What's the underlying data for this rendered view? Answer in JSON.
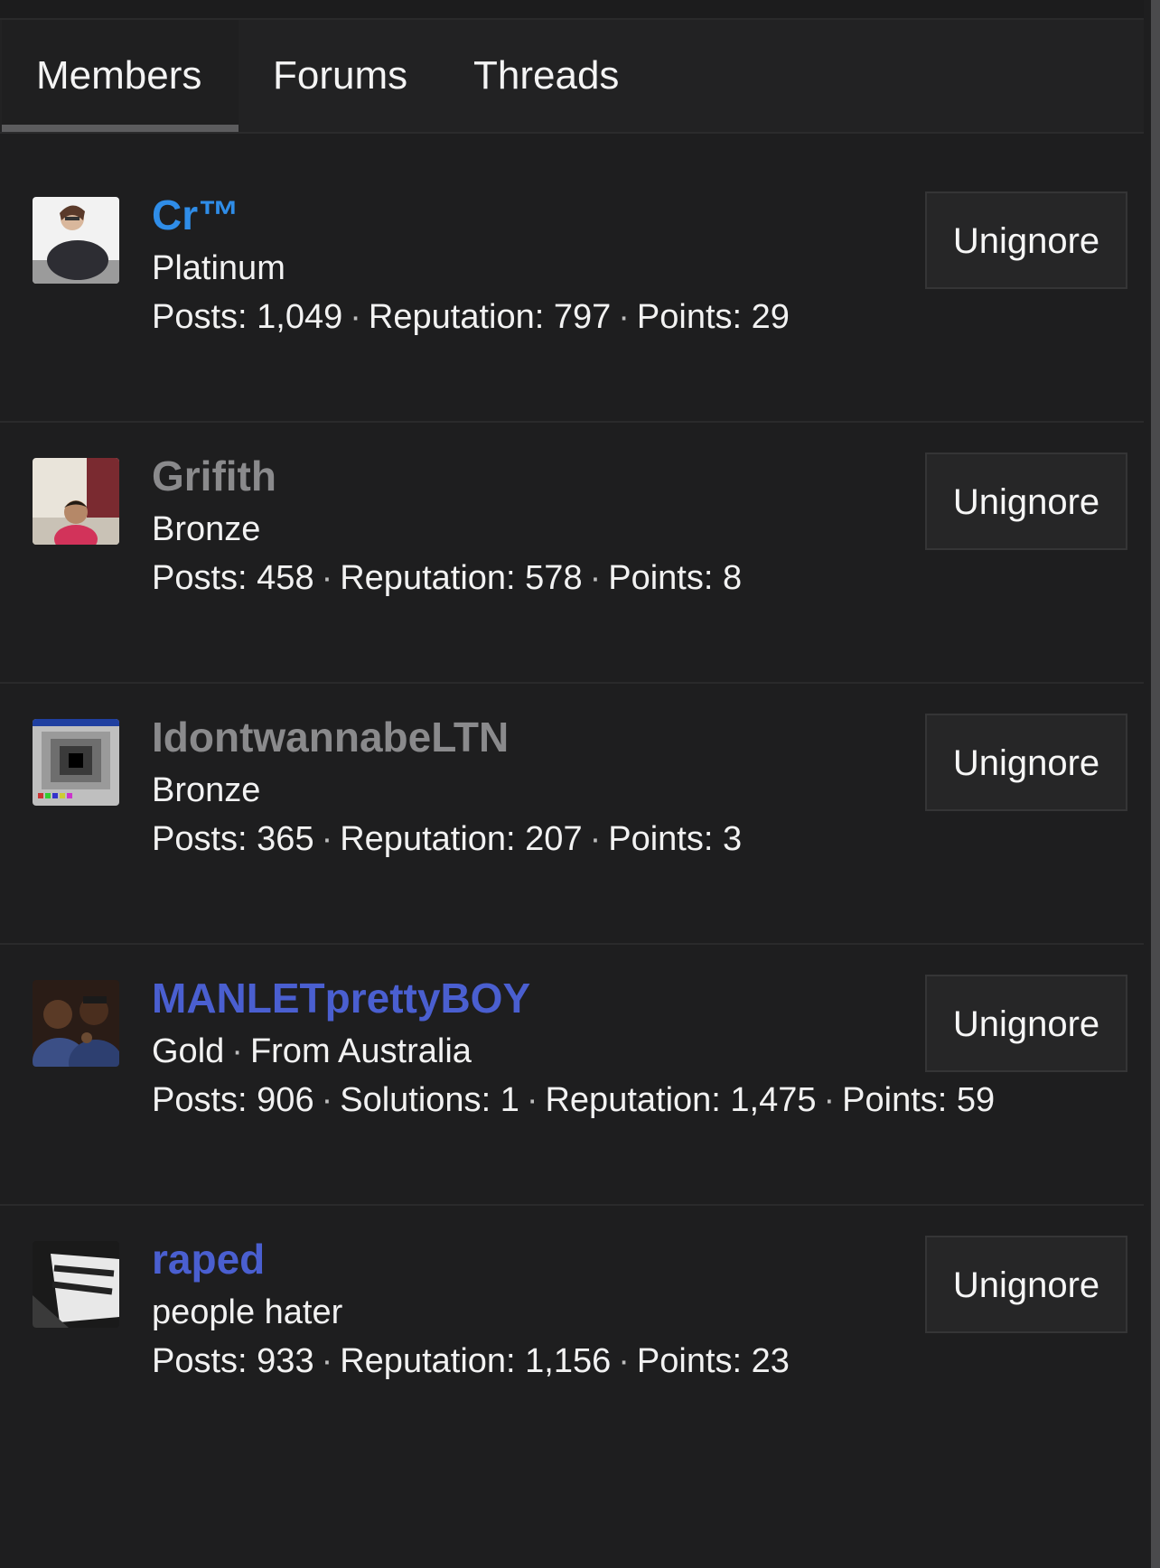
{
  "tabs": [
    {
      "label": "Members",
      "active": true
    },
    {
      "label": "Forums",
      "active": false
    },
    {
      "label": "Threads",
      "active": false
    }
  ],
  "members": [
    {
      "username": "Cr™",
      "username_color": "#2f8de8",
      "title": "Platinum",
      "stats": [
        {
          "label": "Posts",
          "value": "1,049"
        },
        {
          "label": "Reputation",
          "value": "797"
        },
        {
          "label": "Points",
          "value": "29"
        }
      ],
      "button_label": "Unignore"
    },
    {
      "username": "Grifith",
      "username_color": "#8a8a8c",
      "title": "Bronze",
      "stats": [
        {
          "label": "Posts",
          "value": "458"
        },
        {
          "label": "Reputation",
          "value": "578"
        },
        {
          "label": "Points",
          "value": "8"
        }
      ],
      "button_label": "Unignore"
    },
    {
      "username": "IdontwannabeLTN",
      "username_color": "#8a8a8c",
      "title": "Bronze",
      "stats": [
        {
          "label": "Posts",
          "value": "365"
        },
        {
          "label": "Reputation",
          "value": "207"
        },
        {
          "label": "Points",
          "value": "3"
        }
      ],
      "button_label": "Unignore"
    },
    {
      "username": "MANLETprettyBOY",
      "username_color": "#4a5fd0",
      "title": "Gold",
      "location": "From Australia",
      "stats": [
        {
          "label": "Posts",
          "value": "906"
        },
        {
          "label": "Solutions",
          "value": "1"
        },
        {
          "label": "Reputation",
          "value": "1,475"
        },
        {
          "label": "Points",
          "value": "59"
        }
      ],
      "button_label": "Unignore"
    },
    {
      "username": "raped",
      "username_color": "#4a5fd0",
      "title": "people hater",
      "stats": [
        {
          "label": "Posts",
          "value": "933"
        },
        {
          "label": "Reputation",
          "value": "1,156"
        },
        {
          "label": "Points",
          "value": "23"
        }
      ],
      "button_label": "Unignore"
    }
  ]
}
